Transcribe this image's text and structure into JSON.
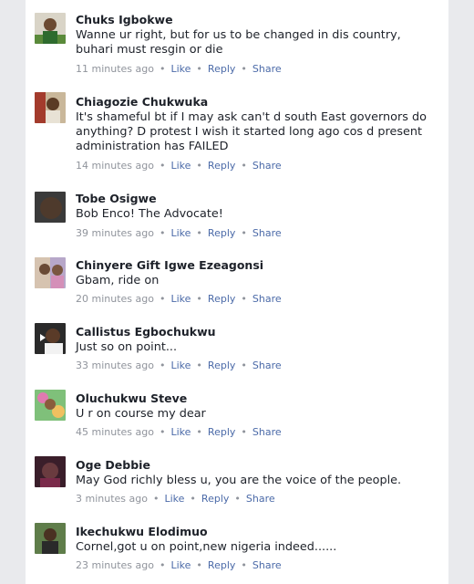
{
  "comments": [
    {
      "author": "Chuks Igbokwe",
      "text": "Wanne ur right, but for us to be changed in dis country, buhari must resgin or die",
      "time": "11 minutes ago",
      "like": "Like",
      "reply": "Reply",
      "share": "Share"
    },
    {
      "author": "Chiagozie Chukwuka",
      "text": "It's shameful bt if I may ask can't d south East governors do anything?  D protest I wish it started long ago cos d present administration has FAILED",
      "time": "14 minutes ago",
      "like": "Like",
      "reply": "Reply",
      "share": "Share"
    },
    {
      "author": "Tobe Osigwe",
      "text": "Bob Enco! The Advocate!",
      "time": "39 minutes ago",
      "like": "Like",
      "reply": "Reply",
      "share": "Share"
    },
    {
      "author": "Chinyere Gift Igwe Ezeagonsi",
      "text": "Gbam, ride on",
      "time": "20 minutes ago",
      "like": "Like",
      "reply": "Reply",
      "share": "Share"
    },
    {
      "author": "Callistus Egbochukwu",
      "text": "Just so on point...",
      "time": "33 minutes ago",
      "like": "Like",
      "reply": "Reply",
      "share": "Share"
    },
    {
      "author": "Oluchukwu Steve",
      "text": "U r on course my dear",
      "time": "45 minutes ago",
      "like": "Like",
      "reply": "Reply",
      "share": "Share"
    },
    {
      "author": "Oge Debbie",
      "text": "May God richly bless u, you are the voice of the people.",
      "time": "3 minutes ago",
      "like": "Like",
      "reply": "Reply",
      "share": "Share"
    },
    {
      "author": "Ikechukwu Elodimuo",
      "text": "Cornel,got u on point,new nigeria indeed......",
      "time": "23 minutes ago",
      "like": "Like",
      "reply": "Reply",
      "share": "Share"
    }
  ]
}
